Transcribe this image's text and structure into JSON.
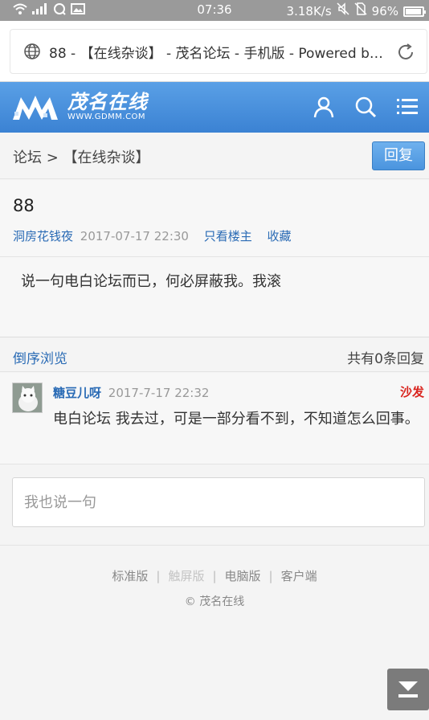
{
  "status_bar": {
    "time": "07:36",
    "network_speed": "3.18K/s",
    "battery": "96%"
  },
  "browser": {
    "page_title": "88 - 【在线杂谈】 - 茂名论坛 - 手机版 - Powered by..."
  },
  "site": {
    "logo_cn": "茂名在线",
    "logo_en": "WWW.GDMM.COM",
    "brand_color": "#4a90dc"
  },
  "breadcrumb": {
    "text": "论坛 > 【在线杂谈】"
  },
  "reply_button": "回复",
  "post": {
    "title": "88",
    "author": "洞房花钱夜",
    "date": "2017-07-17 22:30",
    "only_op_link": "只看楼主",
    "favorite_link": "收藏",
    "body": "说一句电白论坛而已，何必屏蔽我。我滚"
  },
  "replies_header": {
    "sort_link": "倒序浏览",
    "count_text": "共有0条回复"
  },
  "replies": [
    {
      "user": "糖豆儿呀",
      "date": "2017-7-17 22:32",
      "floor": "沙发",
      "body": "电白论坛 我去过，可是一部分看不到，不知道怎么回事。"
    }
  ],
  "quick_reply": {
    "placeholder": "我也说一句"
  },
  "footer": {
    "links": [
      "标准版",
      "触屏版",
      "电脑版",
      "客户端"
    ],
    "separator": "|",
    "copyright": "© 茂名在线"
  }
}
